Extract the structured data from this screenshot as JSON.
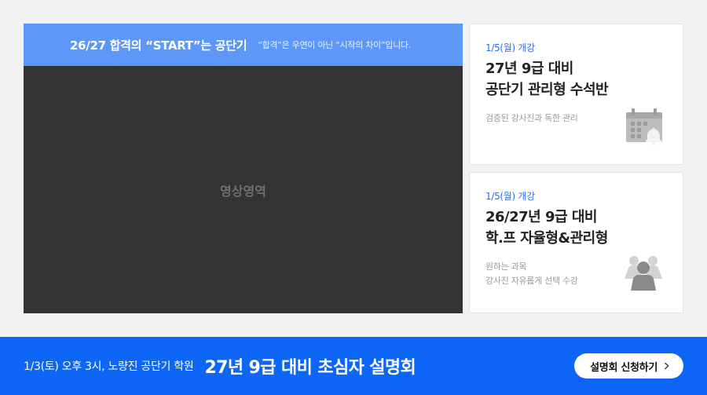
{
  "video": {
    "headline": "26/27 합격의 “START”는 공단기",
    "subline": "“합격”은 우연이 아닌 “시작의 차이”입니다.",
    "placeholder": "영상영역"
  },
  "cards": [
    {
      "open": "1/5(월) 개강",
      "title_line1": "27년 9급 대비",
      "title_line2": "공단기 관리형 수석반",
      "desc_line1": "검증된 강사진과 독한 관리",
      "desc_line2": "",
      "icon": "calendar-alarm-icon"
    },
    {
      "open": "1/5(월) 개강",
      "title_line1": "26/27년 9급 대비",
      "title_line2": "학.프 자율형&관리형",
      "desc_line1": "원하는 과목",
      "desc_line2": "강사진 자유롭게 선택 수강",
      "icon": "people-group-icon"
    }
  ],
  "banner": {
    "info": "1/3(토) 오후 3시, 노량진 공단기 학원",
    "event": "27년 9급 대비 초심자 설명회",
    "button": "설명회 신청하기"
  },
  "colors": {
    "header_blue": "#5d98f9",
    "banner_blue": "#0d66f5",
    "accent_blue": "#2b6de8"
  }
}
